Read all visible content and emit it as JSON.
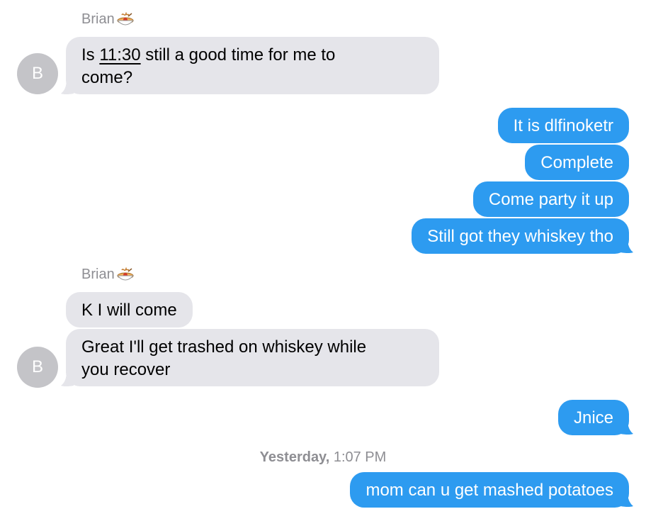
{
  "conversation": {
    "sender_name": "Brian",
    "sender_emoji": "spaghetti-emoji",
    "avatar_initial": "B",
    "messages": [
      {
        "dir": "in",
        "text_parts": [
          "Is ",
          "11:30",
          " still a good time for me to"
        ],
        "line2": "come?"
      },
      {
        "dir": "out",
        "text": "It is dlfinoketr"
      },
      {
        "dir": "out",
        "text": "Complete"
      },
      {
        "dir": "out",
        "text": "Come party it up"
      },
      {
        "dir": "out",
        "text": "Still got they whiskey tho"
      },
      {
        "dir": "in",
        "text": "K I will come"
      },
      {
        "dir": "in",
        "line1": "Great I'll get trashed on whiskey while",
        "line2": "you recover"
      },
      {
        "dir": "out",
        "text": "Jnice"
      },
      {
        "dir": "out",
        "text": "mom can u get mashed potatoes"
      }
    ],
    "timestamp_day": "Yesterday,",
    "timestamp_time": "1:07 PM",
    "colors": {
      "incoming_bubble": "#e5e5ea",
      "outgoing_bubble": "#2d9bf0",
      "avatar": "#c4c4c8",
      "meta_text": "#8e8e93"
    }
  }
}
